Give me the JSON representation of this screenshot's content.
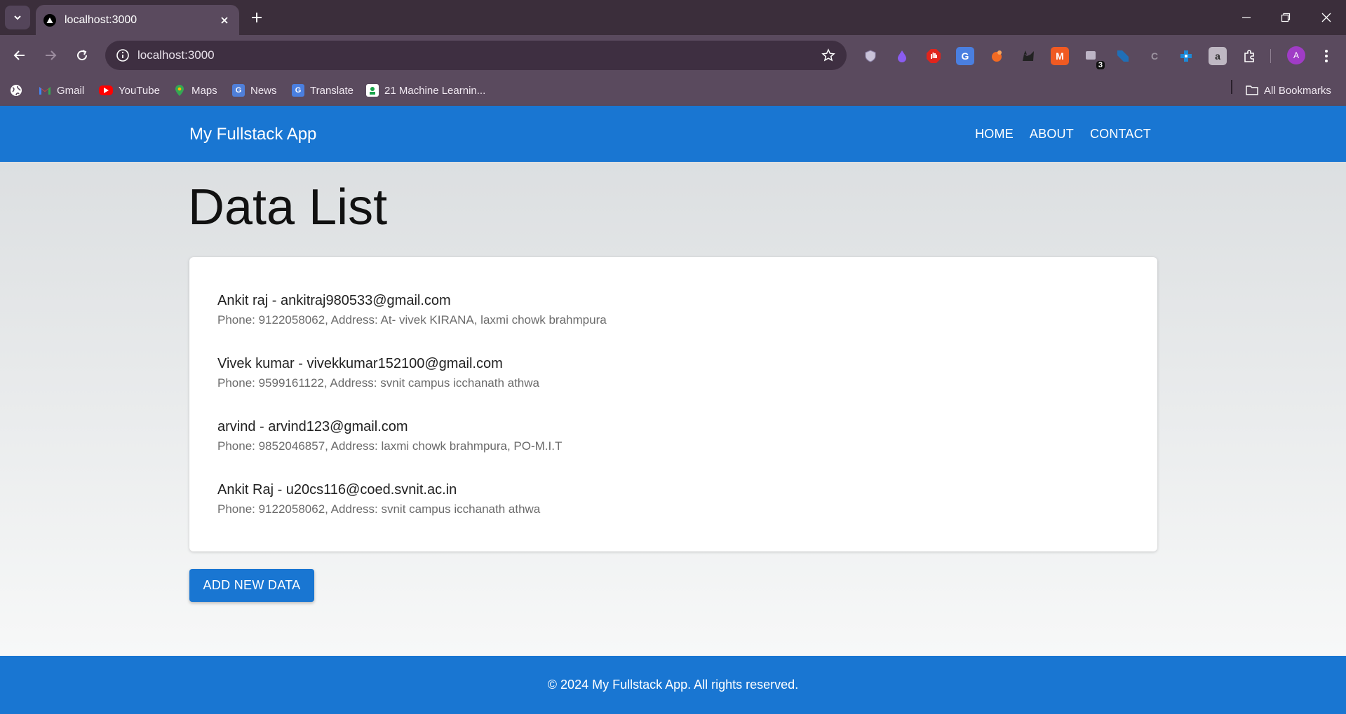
{
  "browser": {
    "tab_title": "localhost:3000",
    "url": "localhost:3000",
    "extension_badge": "3",
    "avatar_letter": "A",
    "bookmarks": [
      {
        "label": "Gmail",
        "icon": "gmail-icon"
      },
      {
        "label": "YouTube",
        "icon": "youtube-icon"
      },
      {
        "label": "Maps",
        "icon": "maps-icon"
      },
      {
        "label": "News",
        "icon": "news-icon"
      },
      {
        "label": "Translate",
        "icon": "translate-icon"
      },
      {
        "label": "21 Machine Learnin...",
        "icon": "bookmark-page-icon"
      }
    ],
    "all_bookmarks": "All Bookmarks"
  },
  "app": {
    "title": "My Fullstack App",
    "nav": [
      "HOME",
      "ABOUT",
      "CONTACT"
    ],
    "page_title": "Data List",
    "items": [
      {
        "primary": "Ankit raj - ankitraj980533@gmail.com",
        "secondary": "Phone: 9122058062, Address: At- vivek KIRANA, laxmi chowk brahmpura"
      },
      {
        "primary": "Vivek kumar - vivekkumar152100@gmail.com",
        "secondary": "Phone: 9599161122, Address: svnit campus icchanath athwa"
      },
      {
        "primary": "arvind - arvind123@gmail.com",
        "secondary": "Phone: 9852046857, Address: laxmi chowk brahmpura, PO-M.I.T"
      },
      {
        "primary": "Ankit Raj - u20cs116@coed.svnit.ac.in",
        "secondary": "Phone: 9122058062, Address: svnit campus icchanath athwa"
      }
    ],
    "add_button": "ADD NEW DATA",
    "footer": "© 2024 My Fullstack App. All rights reserved."
  },
  "colors": {
    "primary": "#1976d2",
    "chrome_frame": "#3b2e3b",
    "chrome_toolbar": "#5a4a5e"
  }
}
